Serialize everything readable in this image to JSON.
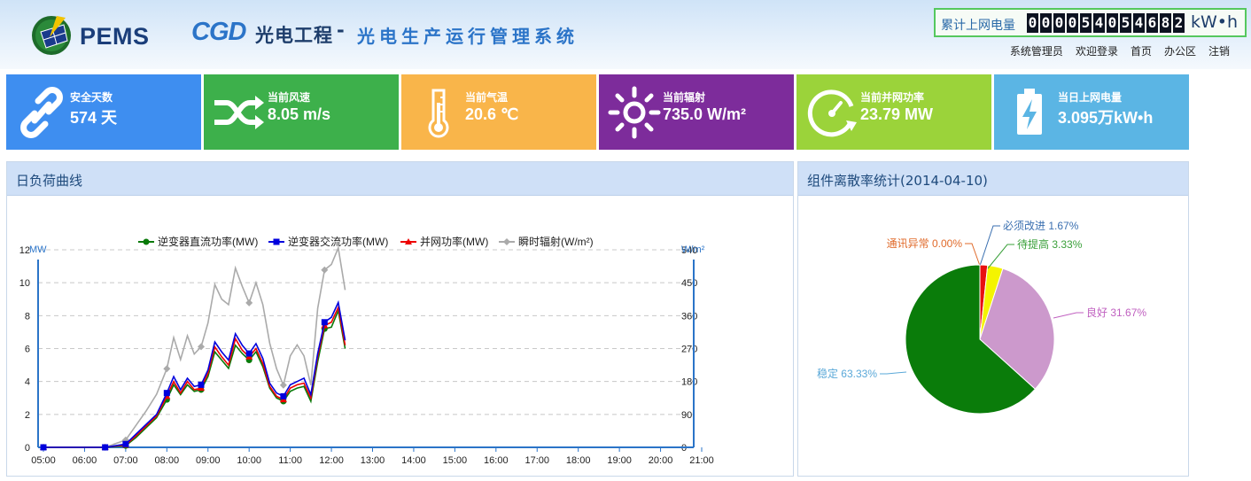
{
  "header": {
    "logo_text": "PEMS",
    "brand": "CGD",
    "brand_cn": "光电工程",
    "brand_dash": "-",
    "subtitle": "光电生产运行管理系统",
    "meter_label": "累计上网电量",
    "meter_digits": [
      "0",
      "0",
      "0",
      "0",
      "5",
      "4",
      "0",
      "5",
      "4",
      "6",
      "8",
      "2"
    ],
    "meter_unit": "kW•h",
    "nav": {
      "user": "系统管理员",
      "welcome": "欢迎登录",
      "home": "首页",
      "office": "办公区",
      "logout": "注销"
    }
  },
  "tiles": [
    {
      "label": "安全天数",
      "value": "574 天",
      "color": "#3e8ef0",
      "icon": "link-icon"
    },
    {
      "label": "当前风速",
      "value": "8.05 m/s",
      "color": "#3db04b",
      "icon": "shuffle-icon"
    },
    {
      "label": "当前气温",
      "value": "20.6 ℃",
      "color": "#f9b54a",
      "icon": "thermometer-icon"
    },
    {
      "label": "当前辐射",
      "value": "735.0 W/m²",
      "color": "#7d2c9b",
      "icon": "sun-icon"
    },
    {
      "label": "当前并网功率",
      "value": "23.79 MW",
      "color": "#9bd33a",
      "icon": "gauge-icon"
    },
    {
      "label": "当日上网电量",
      "value": "3.095万kW•h",
      "color": "#5bb5e4",
      "icon": "battery-icon"
    }
  ],
  "load_panel": {
    "title": "日负荷曲线"
  },
  "pie_panel": {
    "title": "组件离散率统计(2014-04-10)"
  },
  "chart_data": [
    {
      "type": "line",
      "title": "",
      "ylabel_left": "MW",
      "ylabel_right": "W/m²",
      "x_ticks": [
        "05:00",
        "06:00",
        "07:00",
        "08:00",
        "09:00",
        "10:00",
        "11:00",
        "12:00",
        "13:00",
        "14:00",
        "15:00",
        "16:00",
        "17:00",
        "18:00",
        "19:00",
        "20:00",
        "21:00"
      ],
      "ylim_left": [
        0,
        12
      ],
      "ylim_right": [
        0,
        540
      ],
      "y_ticks_left": [
        0,
        2,
        4,
        6,
        8,
        10,
        12
      ],
      "y_ticks_right": [
        0,
        90,
        180,
        270,
        360,
        450,
        540
      ],
      "grid": true,
      "legend_position": "top",
      "x": [
        "05:00",
        "06:00",
        "06:30",
        "07:00",
        "07:15",
        "07:30",
        "07:45",
        "08:00",
        "08:10",
        "08:20",
        "08:30",
        "08:40",
        "08:50",
        "09:00",
        "09:10",
        "09:20",
        "09:30",
        "09:40",
        "09:50",
        "10:00",
        "10:10",
        "10:20",
        "10:30",
        "10:40",
        "10:50",
        "11:00",
        "11:10",
        "11:20",
        "11:30",
        "11:40",
        "11:50",
        "12:00",
        "12:10",
        "12:20",
        "12:30",
        "12:40",
        "12:50",
        "13:00",
        "13:10",
        "13:20",
        "13:30",
        "13:40",
        "13:50",
        "14:00",
        "14:10"
      ],
      "series": [
        {
          "name": "逆变器直流功率(MW)",
          "color": "#0a7a0a",
          "axis": "left",
          "marker": "circle",
          "values": [
            0,
            0,
            0,
            0.1,
            0.6,
            1.2,
            1.8,
            2.9,
            3.8,
            3.2,
            3.8,
            3.4,
            3.5,
            4.3,
            5.8,
            5.3,
            4.8,
            6.2,
            5.7,
            5.3,
            5.8,
            4.9,
            3.6,
            3.0,
            2.8,
            3.4,
            3.6,
            3.7,
            2.8,
            5.2,
            7.2,
            7.3,
            8.3,
            6.0,
            0,
            0,
            0,
            0,
            0,
            0,
            0,
            0,
            0,
            0,
            0
          ]
        },
        {
          "name": "逆变器交流功率(MW)",
          "color": "#0000dd",
          "axis": "left",
          "marker": "square",
          "values": [
            0,
            0,
            0,
            0.2,
            0.8,
            1.4,
            2.0,
            3.3,
            4.3,
            3.5,
            4.2,
            3.7,
            3.8,
            4.7,
            6.4,
            5.8,
            5.3,
            6.9,
            6.2,
            5.7,
            6.3,
            5.4,
            3.9,
            3.3,
            3.1,
            3.8,
            4.0,
            4.2,
            3.2,
            5.7,
            7.6,
            7.9,
            8.8,
            6.5,
            0,
            0,
            0,
            0,
            0,
            0,
            0,
            0,
            0,
            0,
            0
          ]
        },
        {
          "name": "并网功率(MW)",
          "color": "#ee0000",
          "axis": "left",
          "marker": "triangle",
          "values": [
            0,
            0,
            0,
            0.15,
            0.7,
            1.3,
            1.9,
            3.1,
            4.0,
            3.3,
            4.0,
            3.5,
            3.6,
            4.5,
            6.1,
            5.5,
            5.0,
            6.6,
            5.9,
            5.5,
            6.0,
            5.1,
            3.7,
            3.1,
            2.9,
            3.6,
            3.8,
            3.9,
            3.0,
            5.5,
            7.4,
            7.6,
            8.5,
            6.2,
            0,
            0,
            0,
            0,
            0,
            0,
            0,
            0,
            0,
            0,
            0
          ]
        },
        {
          "name": "瞬时辐射(W/m²)",
          "color": "#aaaaaa",
          "axis": "right",
          "marker": "diamond",
          "values": [
            0,
            0,
            0,
            20,
            60,
            100,
            145,
            215,
            300,
            240,
            305,
            255,
            275,
            340,
            445,
            405,
            390,
            490,
            440,
            395,
            450,
            390,
            285,
            215,
            170,
            250,
            280,
            250,
            170,
            380,
            485,
            500,
            545,
            430,
            0,
            0,
            0,
            0,
            0,
            0,
            0,
            0,
            0,
            0,
            0
          ]
        }
      ]
    },
    {
      "type": "pie",
      "title": "组件离散率统计(2014-04-10)",
      "labels": [
        "必须改进",
        "通讯异常",
        "待提高",
        "良好",
        "稳定"
      ],
      "values": [
        1.67,
        0.0,
        3.33,
        31.67,
        63.33
      ],
      "label_texts": [
        "必须改进 1.67%",
        "通讯异常 0.00%",
        "待提高 3.33%",
        "良好 31.67%",
        "稳定 63.33%"
      ],
      "colors": [
        "#e81010",
        "#ff6a00",
        "#f4f400",
        "#cc99cc",
        "#0a7c0a"
      ],
      "label_colors": [
        "#3a6fb0",
        "#e06a2a",
        "#3aa03a",
        "#c060c0",
        "#5aa8d8"
      ]
    }
  ]
}
